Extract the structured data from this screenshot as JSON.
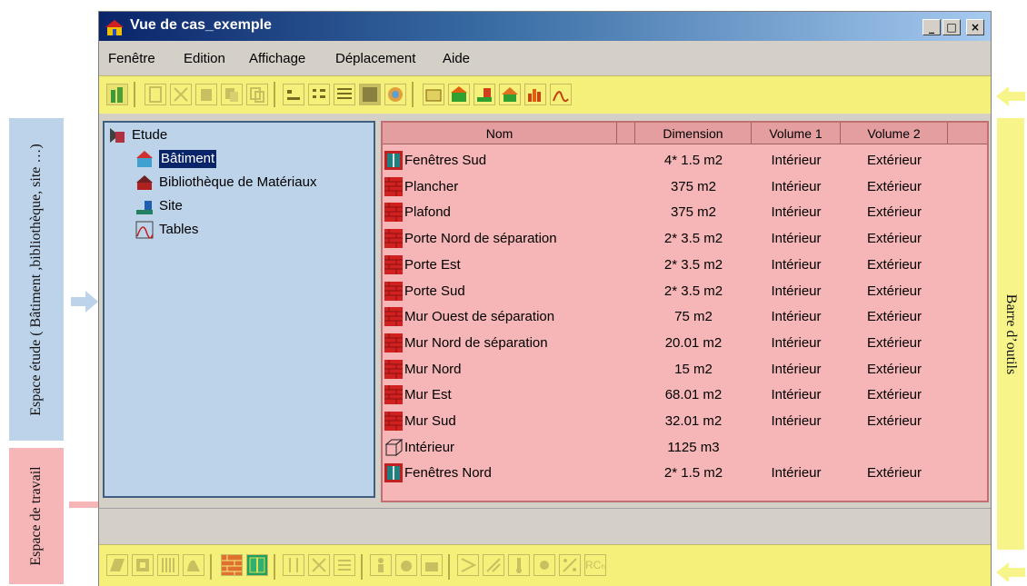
{
  "annotations": {
    "etude": "Espace étude ( Bâtiment ,bibliothèque, site …)",
    "travail": "Espace de travail",
    "outils": "Barre d’outils",
    "colors": {
      "blue": "#bcd3e9",
      "pink": "#f6b6b7",
      "yellow": "#f7f48a"
    }
  },
  "window": {
    "title": "Vue de cas_exemple",
    "min": "_",
    "max": "□",
    "close": "×"
  },
  "menu": {
    "items": [
      "Fenêtre",
      "Edition",
      "Affichage",
      "Déplacement",
      "Aide"
    ]
  },
  "tree": {
    "root": "Etude",
    "items": [
      "Bâtiment",
      "Bibliothèque de Matériaux",
      "Site",
      "Tables"
    ],
    "selected": "Bâtiment"
  },
  "table": {
    "headers": [
      "Nom",
      "Dimension",
      "Volume 1",
      "Volume 2"
    ],
    "rows": [
      {
        "icon": "window-icon",
        "nom": "Fenêtres Sud",
        "dim": "4* 1.5 m2",
        "v1": "Intérieur",
        "v2": "Extérieur"
      },
      {
        "icon": "brick-icon",
        "nom": "Plancher",
        "dim": "375 m2",
        "v1": "Intérieur",
        "v2": "Extérieur"
      },
      {
        "icon": "brick-icon",
        "nom": "Plafond",
        "dim": "375 m2",
        "v1": "Intérieur",
        "v2": "Extérieur"
      },
      {
        "icon": "brick-icon",
        "nom": "Porte Nord de séparation",
        "dim": "2* 3.5 m2",
        "v1": "Intérieur",
        "v2": "Extérieur"
      },
      {
        "icon": "brick-icon",
        "nom": "Porte Est",
        "dim": "2* 3.5 m2",
        "v1": "Intérieur",
        "v2": "Extérieur"
      },
      {
        "icon": "brick-icon",
        "nom": "Porte Sud",
        "dim": "2* 3.5 m2",
        "v1": "Intérieur",
        "v2": "Extérieur"
      },
      {
        "icon": "brick-icon",
        "nom": "Mur Ouest de séparation",
        "dim": "75 m2",
        "v1": "Intérieur",
        "v2": "Extérieur"
      },
      {
        "icon": "brick-icon",
        "nom": "Mur Nord de séparation",
        "dim": "20.01 m2",
        "v1": "Intérieur",
        "v2": "Extérieur"
      },
      {
        "icon": "brick-icon",
        "nom": "Mur Nord",
        "dim": "15 m2",
        "v1": "Intérieur",
        "v2": "Extérieur"
      },
      {
        "icon": "brick-icon",
        "nom": "Mur Est",
        "dim": "68.01 m2",
        "v1": "Intérieur",
        "v2": "Extérieur"
      },
      {
        "icon": "brick-icon",
        "nom": "Mur Sud",
        "dim": "32.01 m2",
        "v1": "Intérieur",
        "v2": "Extérieur"
      },
      {
        "icon": "cube-icon",
        "nom": "Intérieur",
        "dim": "1125 m3",
        "v1": "",
        "v2": ""
      },
      {
        "icon": "window-icon",
        "nom": "Fenêtres Nord",
        "dim": "2* 1.5 m2",
        "v1": "Intérieur",
        "v2": "Extérieur"
      }
    ]
  },
  "toolbar_bottom": {
    "last_label": "RCₕ"
  }
}
